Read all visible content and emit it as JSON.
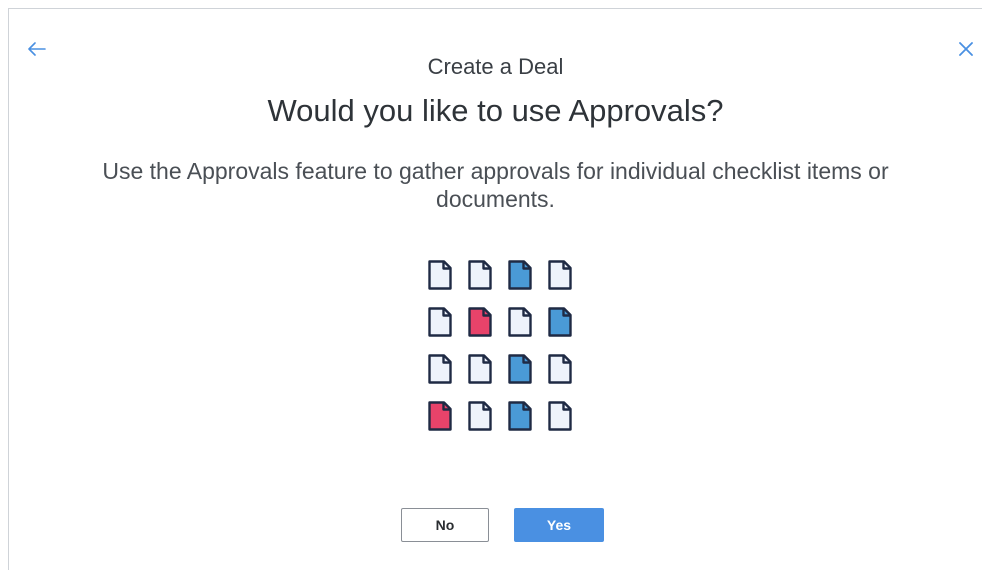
{
  "dialog": {
    "subtitle": "Create a Deal",
    "title": "Would you like to use Approvals?",
    "description": "Use the Approvals feature to gather approvals for individual checklist items or documents.",
    "no_label": "No",
    "yes_label": "Yes"
  },
  "icons": {
    "back": "arrow-left-icon",
    "close": "close-icon",
    "document": "document-icon"
  },
  "colors": {
    "accent": "#4a90e2",
    "doc_blank": "#eef3fb",
    "doc_blue": "#4a9ad6",
    "doc_red": "#e8436a",
    "doc_outline": "#1f2a44"
  },
  "document_grid": [
    [
      "blank",
      "blank",
      "blue",
      "blank"
    ],
    [
      "blank",
      "red",
      "blank",
      "blue"
    ],
    [
      "blank",
      "blank",
      "blue",
      "blank"
    ],
    [
      "red",
      "blank",
      "blue",
      "blank"
    ]
  ]
}
